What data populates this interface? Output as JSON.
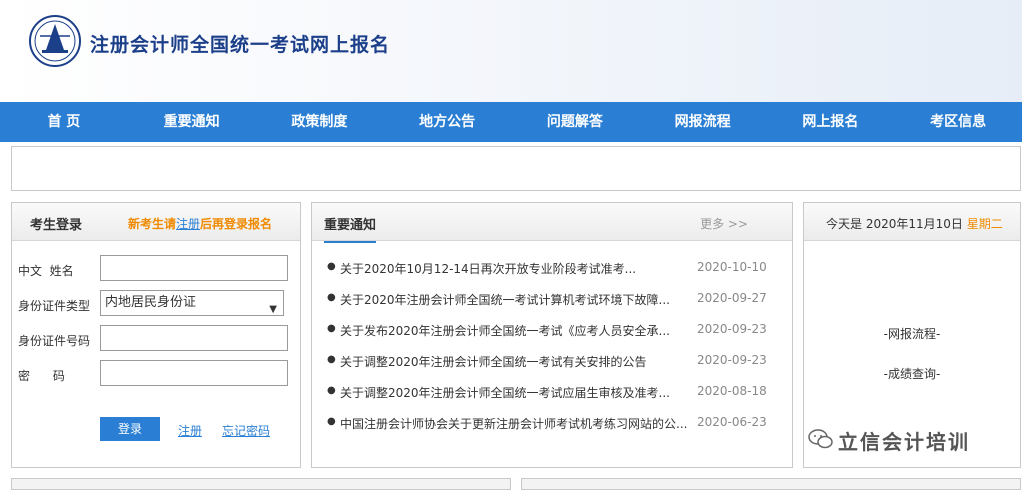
{
  "header": {
    "title": "注册会计师全国统一考试网上报名"
  },
  "nav": [
    {
      "label": "首 页"
    },
    {
      "label": "重要通知"
    },
    {
      "label": "政策制度"
    },
    {
      "label": "地方公告"
    },
    {
      "label": "问题解答"
    },
    {
      "label": "网报流程"
    },
    {
      "label": "网上报名"
    },
    {
      "label": "考区信息"
    }
  ],
  "login": {
    "title": "考生登录",
    "hint_pre": "新考生请",
    "hint_link": "注册",
    "hint_post": "后再登录报名",
    "fields": {
      "name_label": "中文  姓名",
      "idtype_label": "身份证件类型",
      "idtype_value": "内地居民身份证",
      "idnum_label": "身份证件号码",
      "password_label": "密      码"
    },
    "login_button": "登录",
    "register_link": "注册",
    "forgot_link": "忘记密码"
  },
  "news": {
    "title": "重要通知",
    "more": "更多 >>",
    "items": [
      {
        "text": "关于2020年10月12-14日再次开放专业阶段考试准考...",
        "date": "2020-10-10"
      },
      {
        "text": "关于2020年注册会计师全国统一考试计算机考试环境下故障...",
        "date": "2020-09-27"
      },
      {
        "text": "关于发布2020年注册会计师全国统一考试《应考人员安全承...",
        "date": "2020-09-23"
      },
      {
        "text": "关于调整2020年注册会计师全国统一考试有关安排的公告",
        "date": "2020-09-23"
      },
      {
        "text": "关于调整2020年注册会计师全国统一考试应届生审核及准考...",
        "date": "2020-08-18"
      },
      {
        "text": "中国注册会计师协会关于更新注册会计师考试机考练习网站的公...",
        "date": "2020-06-23"
      }
    ]
  },
  "datebox": {
    "prefix": "今天是 2020年11月10日",
    "weekday": "星期二",
    "links": [
      "-网报流程-",
      "-成绩查询-"
    ]
  },
  "watermark": {
    "text": "立信会计培训",
    "icon": "wechat-icon"
  },
  "colors": {
    "nav": "#2a7fd4",
    "accent": "#f08a00",
    "title": "#1c3f8a"
  }
}
